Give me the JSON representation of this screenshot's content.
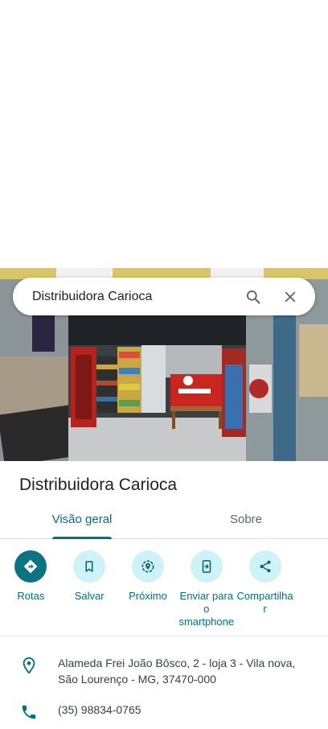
{
  "search": {
    "query": "Distribuidora Carioca"
  },
  "place": {
    "name": "Distribuidora Carioca"
  },
  "tabs": [
    {
      "label": "Visão geral",
      "active": true
    },
    {
      "label": "Sobre",
      "active": false
    }
  ],
  "actions": [
    {
      "label": "Rotas",
      "icon": "directions-icon"
    },
    {
      "label": "Salvar",
      "icon": "bookmark-icon"
    },
    {
      "label": "Próximo",
      "icon": "nearby-icon"
    },
    {
      "label": "Enviar para o smartphone",
      "icon": "send-to-phone-icon"
    },
    {
      "label": "Compartilhar",
      "icon": "share-icon"
    }
  ],
  "info": {
    "address": "Alameda Frei João Bôsco, 2 - loja 3 - Vila nova, São Lourenço - MG, 37470-000",
    "phone": "(35) 98834-0765"
  },
  "colors": {
    "accent": "#00727e",
    "primary_button": "#0b7482",
    "secondary_button": "#cdf3f8"
  }
}
